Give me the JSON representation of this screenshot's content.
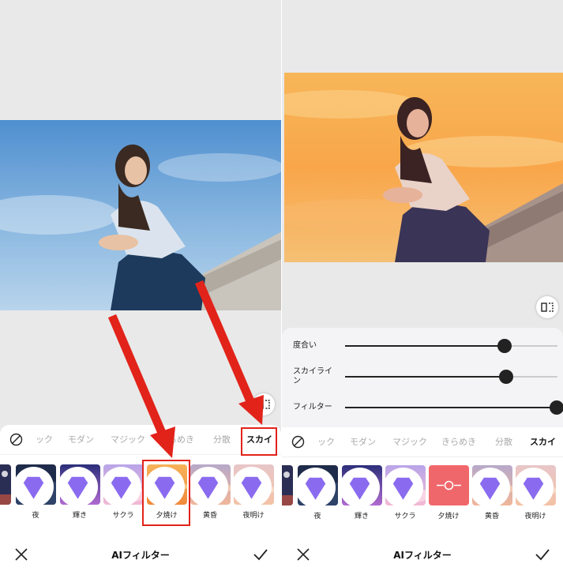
{
  "left_panel": {
    "tabs": [
      "ック",
      "モダン",
      "マジック",
      "きらめき",
      "分散",
      "スカイ"
    ],
    "active_tab": "スカイ",
    "filters": [
      {
        "label": "夜",
        "icon": "night-thumbnail"
      },
      {
        "label": "輝き",
        "icon": "sparkle-thumbnail"
      },
      {
        "label": "サクラ",
        "icon": "sakura-thumbnail"
      },
      {
        "label": "夕焼け",
        "icon": "sunset-thumbnail"
      },
      {
        "label": "黄昏",
        "icon": "dusk-thumbnail"
      },
      {
        "label": "夜明け",
        "icon": "dawn-thumbnail"
      }
    ],
    "selected_filter": "夕焼け",
    "title": "AIフィルター"
  },
  "right_panel": {
    "sliders": [
      {
        "label": "度合い",
        "value": 0.75
      },
      {
        "label": "スカイライン",
        "value": 0.76
      },
      {
        "label": "フィルター",
        "value": 1.0
      }
    ],
    "tabs": [
      "ック",
      "モダン",
      "マジック",
      "きらめき",
      "分散",
      "スカイ"
    ],
    "active_tab": "スカイ",
    "filters": [
      {
        "label": "夜",
        "icon": "night-thumbnail"
      },
      {
        "label": "輝き",
        "icon": "sparkle-thumbnail"
      },
      {
        "label": "サクラ",
        "icon": "sakura-thumbnail"
      },
      {
        "label": "夕焼け",
        "icon": "adjust-slider-icon"
      },
      {
        "label": "黄昏",
        "icon": "dusk-thumbnail"
      },
      {
        "label": "夜明け",
        "icon": "dawn-thumbnail"
      }
    ],
    "selected_filter": "夕焼け",
    "title": "AIフィルター"
  },
  "colors": {
    "accent": "#e2231a",
    "sky_blue": "#5d95cc",
    "sunset_orange": "#f6a64d",
    "slider_dark": "#222222"
  }
}
